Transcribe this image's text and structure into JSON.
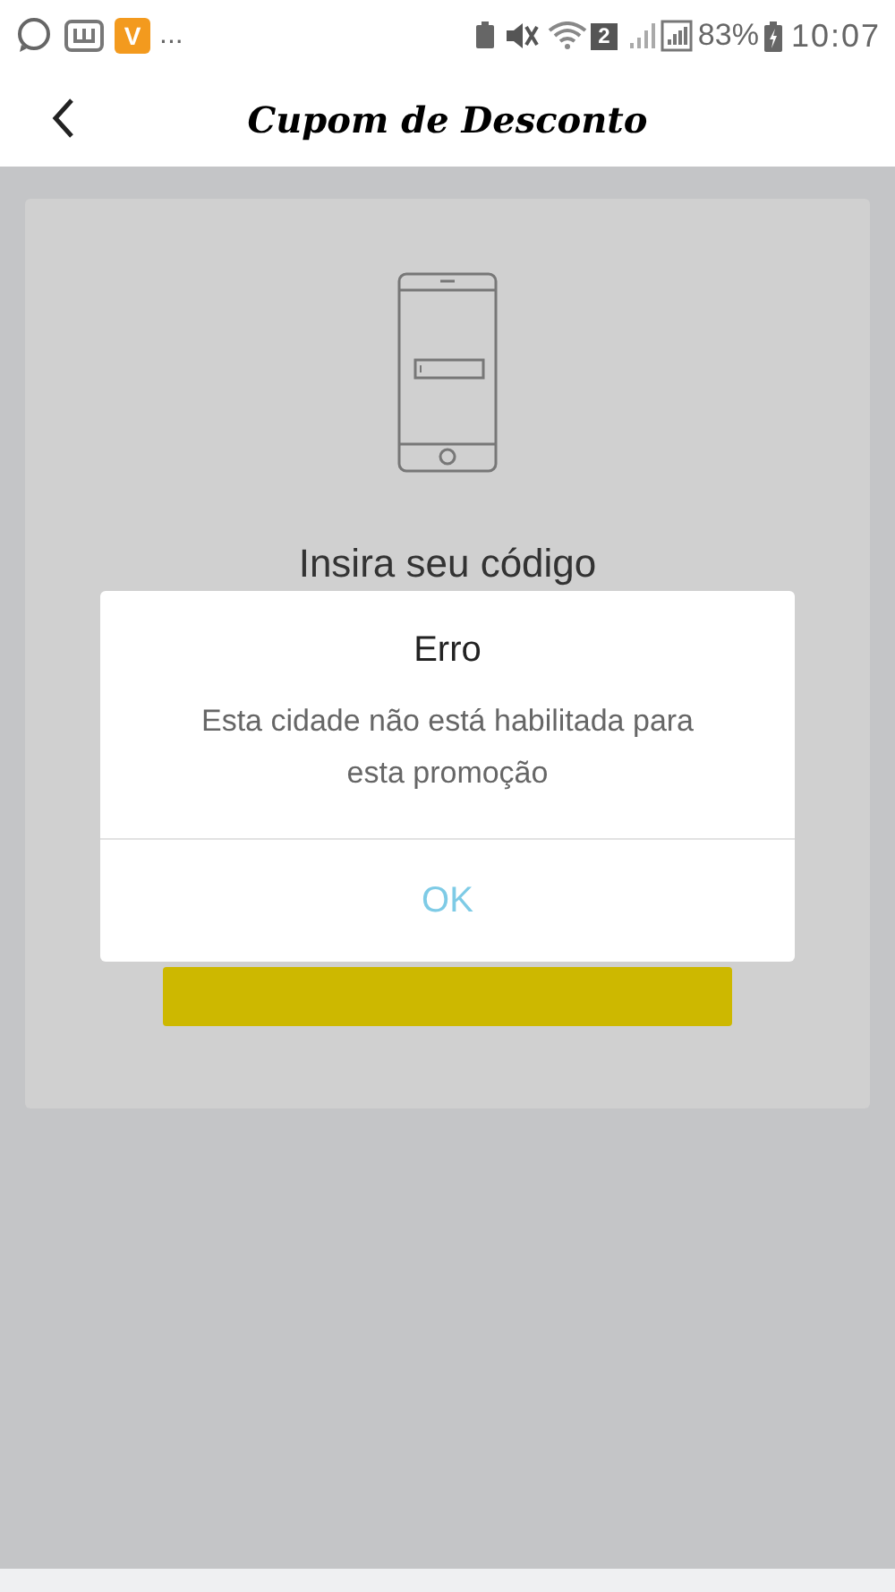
{
  "status_bar": {
    "app_badge": "V",
    "more": "...",
    "sim_badge": "2",
    "battery": "83%",
    "time": "10:07"
  },
  "header": {
    "title": "Cupom de Desconto"
  },
  "card": {
    "heading": "Insira seu código"
  },
  "dialog": {
    "title": "Erro",
    "message": "Esta cidade não está habilitada para esta promoção",
    "buttons": [
      "OK"
    ]
  }
}
